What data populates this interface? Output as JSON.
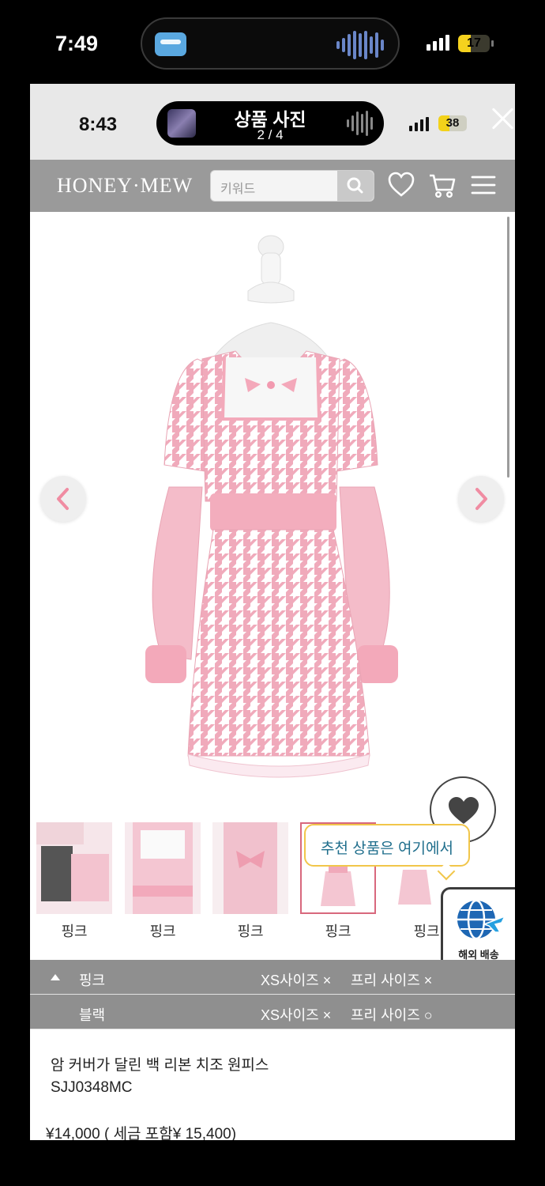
{
  "outer_status": {
    "time": "7:49",
    "battery": "17",
    "app_icon": "LAFTEL",
    "colors": {
      "battery": "#f5d21e"
    }
  },
  "inner_status": {
    "time": "8:43",
    "battery": "38"
  },
  "viewer": {
    "title": "상품 사진",
    "counter": "2 / 4",
    "close_icon": "close-icon"
  },
  "site": {
    "logo": "HONEY·MEW",
    "search_placeholder": "키워드",
    "icons": [
      "search-icon",
      "heart-icon",
      "cart-icon",
      "menu-icon"
    ]
  },
  "product_image": {
    "alt": "pink houndstooth dress on mannequin"
  },
  "thumbnails": [
    {
      "label": "핑크",
      "selected": false
    },
    {
      "label": "핑크",
      "selected": false
    },
    {
      "label": "핑크",
      "selected": false
    },
    {
      "label": "핑크",
      "selected": true
    },
    {
      "label": "핑크",
      "selected": false
    }
  ],
  "tooltip": "추천 상품은 여기에서",
  "overseas_label": "해외 배송",
  "options": [
    {
      "color": "핑크",
      "opt1": "XS사이즈 ×",
      "opt2": "프리 사이즈 ×"
    },
    {
      "color": "블랙",
      "opt1": "XS사이즈 ×",
      "opt2": "프리 사이즈 ○"
    }
  ],
  "product": {
    "name": "암 커버가 달린 백 리본 치조 원피스",
    "code": "SJJ0348MC",
    "price": "¥14,000  ( 세금 포함¥ 15,400)"
  },
  "colors": {
    "header_bg": "#9a9a9a",
    "accent_pink": "#f2b8c6",
    "tooltip_border": "#f1c64a"
  }
}
